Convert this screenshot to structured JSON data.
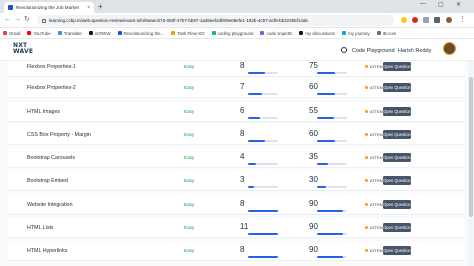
{
  "browser": {
    "tab_title": "Revolutionizing the Job Market",
    "new_tab_label": "+",
    "url": "learning.ccbp.in/web-question-review/exam-info/6eaec575-050f-47b7-bb97-1ad6eefa3f8/9e09efe1-182b-4c57-acf9-bb22355f14ab",
    "bookmarks": [
      {
        "label": "Gmail",
        "color": "#ea4335"
      },
      {
        "label": "YouTube",
        "color": "#ff0000"
      },
      {
        "label": "Translate",
        "color": "#4285f4"
      },
      {
        "label": "xCREW",
        "color": "#111827"
      },
      {
        "label": "Revolutionizing the...",
        "color": "#1f4fd1"
      },
      {
        "label": "Task Flow-XO",
        "color": "#f59e0b"
      },
      {
        "label": "coding playground",
        "color": "#10b981"
      },
      {
        "label": "code snipetts",
        "color": "#6366f1"
      },
      {
        "label": "my discussions",
        "color": "#111827"
      },
      {
        "label": "my journey",
        "color": "#0ea5e9"
      },
      {
        "label": "IB.com",
        "color": "#64748b"
      }
    ]
  },
  "header": {
    "logo_line1": "NXT",
    "logo_line2": "WAVE",
    "code_playground": "Code Playground",
    "user_name": "Harish Reddy"
  },
  "rows": [
    {
      "title": "Flexbox Properties-1",
      "difficulty": "Easy",
      "v1": "8",
      "v1_pct": 55,
      "v2": "75",
      "v2_pct": 60,
      "status": "ATTEMPTED",
      "button": "Open Question"
    },
    {
      "title": "Flexbox Properties-2",
      "difficulty": "Easy",
      "v1": "7",
      "v1_pct": 45,
      "v2": "60",
      "v2_pct": 60,
      "status": "ATTEMPTED",
      "button": "Open Question"
    },
    {
      "title": "HTML Images",
      "difficulty": "Easy",
      "v1": "6",
      "v1_pct": 40,
      "v2": "55",
      "v2_pct": 55,
      "status": "ATTEMPTED",
      "button": "Open Question"
    },
    {
      "title": "CSS Box Property - Margin",
      "difficulty": "Easy",
      "v1": "8",
      "v1_pct": 55,
      "v2": "60",
      "v2_pct": 60,
      "status": "ATTEMPTED",
      "button": "Open Question"
    },
    {
      "title": "Bootstrap Carousels",
      "difficulty": "Easy",
      "v1": "4",
      "v1_pct": 25,
      "v2": "35",
      "v2_pct": 35,
      "status": "ATTEMPTED",
      "button": "Open Question"
    },
    {
      "title": "Bootstrap Embed",
      "difficulty": "Easy",
      "v1": "3",
      "v1_pct": 20,
      "v2": "30",
      "v2_pct": 30,
      "status": "ATTEMPTED",
      "button": "Open Question"
    },
    {
      "title": "Website Integration",
      "difficulty": "Easy",
      "v1": "8",
      "v1_pct": 100,
      "v2": "90",
      "v2_pct": 85,
      "status": "ATTEMPTED",
      "button": "Open Question"
    },
    {
      "title": "HTML Lists",
      "difficulty": "Easy",
      "v1": "11",
      "v1_pct": 100,
      "v2": "90",
      "v2_pct": 85,
      "status": "ATTEMPTED",
      "button": "Open Question"
    },
    {
      "title": "HTML Hyperlinks",
      "difficulty": "Easy",
      "v1": "8",
      "v1_pct": 100,
      "v2": "90",
      "v2_pct": 85,
      "status": "ATTEMPTED",
      "button": "Open Question"
    }
  ]
}
